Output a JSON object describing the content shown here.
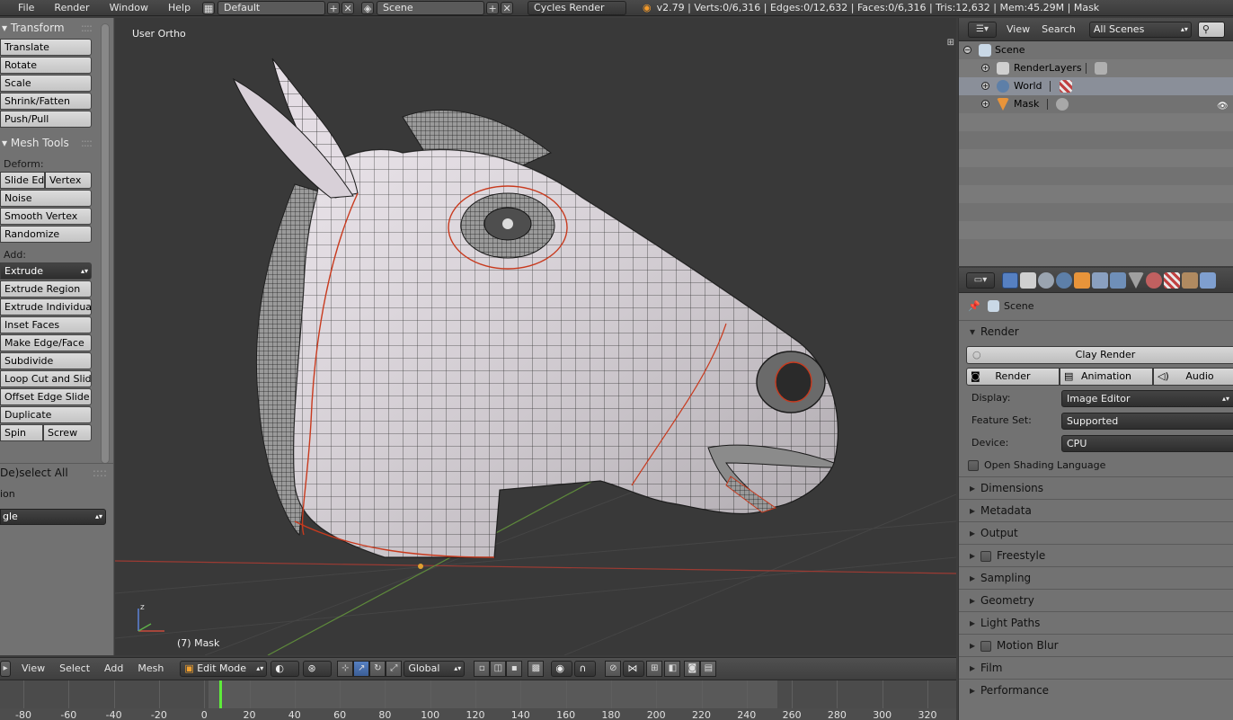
{
  "app": {
    "menus": [
      "File",
      "Render",
      "Window",
      "Help"
    ],
    "screen_layout": "Default",
    "scene": "Scene",
    "render_engine": "Cycles Render",
    "stats": "v2.79 | Verts:0/6,316 | Edges:0/12,632 | Faces:0/6,316 | Tris:12,632 | Mem:45.29M | Mask"
  },
  "toolshelf": {
    "transform_header": "Transform",
    "transform_buttons": [
      "Translate",
      "Rotate",
      "Scale",
      "Shrink/Fatten",
      "Push/Pull"
    ],
    "mesh_tools_header": "Mesh Tools",
    "deform_label": "Deform:",
    "slide_edge": "Slide Ed",
    "vertex": "Vertex",
    "deform_buttons": [
      "Noise",
      "Smooth Vertex",
      "Randomize"
    ],
    "add_label": "Add:",
    "extrude": "Extrude",
    "add_buttons": [
      "Extrude Region",
      "Extrude Individual",
      "Inset Faces",
      "Make Edge/Face",
      "Subdivide",
      "Loop Cut and Slide",
      "Offset Edge Slide",
      "Duplicate"
    ],
    "spin": "Spin",
    "screw": "Screw",
    "operator_header": "De)select All",
    "operator_action_label": "ion",
    "operator_action_value": "gle"
  },
  "viewport": {
    "view_name": "User Ortho",
    "object_label": "(7) Mask",
    "axis_z": "z"
  },
  "viewport_header": {
    "menus": [
      "View",
      "Select",
      "Add",
      "Mesh"
    ],
    "mode": "Edit Mode",
    "orientation": "Global"
  },
  "timeline": {
    "ticks": [
      "-80",
      "-60",
      "-40",
      "-20",
      "0",
      "20",
      "40",
      "60",
      "80",
      "100",
      "120",
      "140",
      "160",
      "180",
      "200",
      "220",
      "240",
      "260",
      "280",
      "300",
      "320"
    ],
    "current_frame": 7
  },
  "outliner": {
    "menus": [
      "View",
      "Search"
    ],
    "scene_filter": "All Scenes",
    "items": [
      {
        "label": "Scene"
      },
      {
        "label": "RenderLayers"
      },
      {
        "label": "World"
      },
      {
        "label": "Mask"
      }
    ]
  },
  "properties": {
    "breadcrumb": "Scene",
    "render_header": "Render",
    "render_preset": "Clay Render",
    "tab_render": "Render",
    "tab_animation": "Animation",
    "tab_audio": "Audio",
    "display_label": "Display:",
    "display_value": "Image Editor",
    "feature_label": "Feature Set:",
    "feature_value": "Supported",
    "device_label": "Device:",
    "device_value": "CPU",
    "osl_label": "Open Shading Language",
    "panels": [
      {
        "label": "Dimensions",
        "checkbox": false
      },
      {
        "label": "Metadata",
        "checkbox": false
      },
      {
        "label": "Output",
        "checkbox": false
      },
      {
        "label": "Freestyle",
        "checkbox": true
      },
      {
        "label": "Sampling",
        "checkbox": false
      },
      {
        "label": "Geometry",
        "checkbox": false
      },
      {
        "label": "Light Paths",
        "checkbox": false
      },
      {
        "label": "Motion Blur",
        "checkbox": true
      },
      {
        "label": "Film",
        "checkbox": false
      },
      {
        "label": "Performance",
        "checkbox": false
      }
    ]
  },
  "colors": {
    "accent_blue": "#5680c2",
    "frame_marker": "#5eec3a",
    "seam_red": "#c83a1e"
  }
}
